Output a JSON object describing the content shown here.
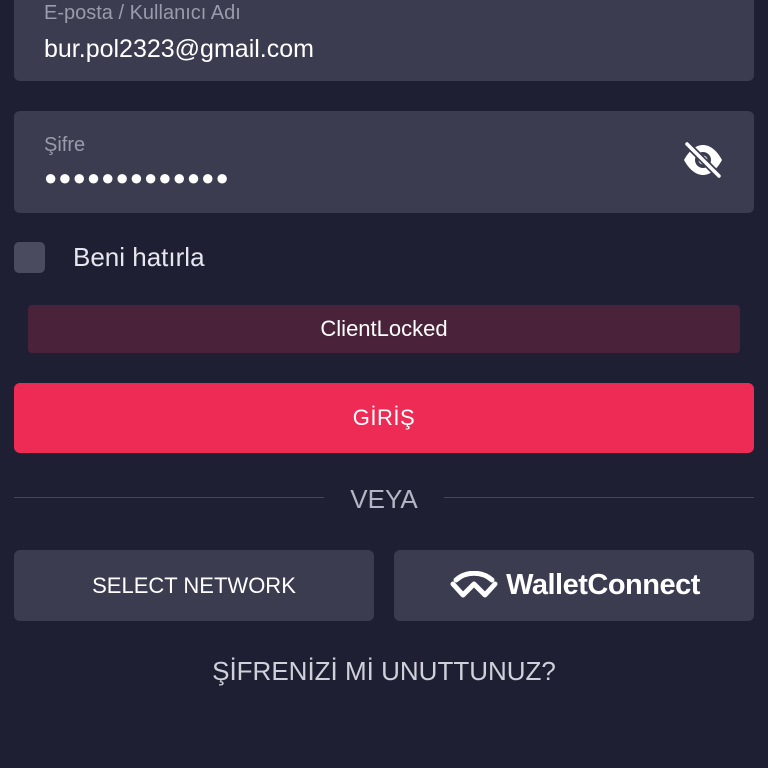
{
  "email": {
    "label": "E-posta / Kullanıcı Adı",
    "value": "bur.pol2323@gmail.com"
  },
  "password": {
    "label": "Şifre",
    "value": "●●●●●●●●●●●●●",
    "toggle_icon": "eye-off-icon"
  },
  "remember": {
    "label": "Beni hatırla",
    "checked": false
  },
  "error": {
    "message": "ClientLocked",
    "color": "#4a2239"
  },
  "login_button": {
    "label": "GİRİŞ",
    "color": "#ee2b55"
  },
  "divider": {
    "label": "VEYA"
  },
  "select_network": {
    "label": "SELECT NETWORK"
  },
  "wallet_connect": {
    "label": "WalletConnect",
    "icon": "walletconnect-logo-icon"
  },
  "forgot_password": {
    "label": "ŞİFRENİZİ Mİ UNUTTUNUZ?"
  },
  "colors": {
    "background": "#1f1f33",
    "field": "#3b3c50",
    "accent": "#ee2b55"
  }
}
